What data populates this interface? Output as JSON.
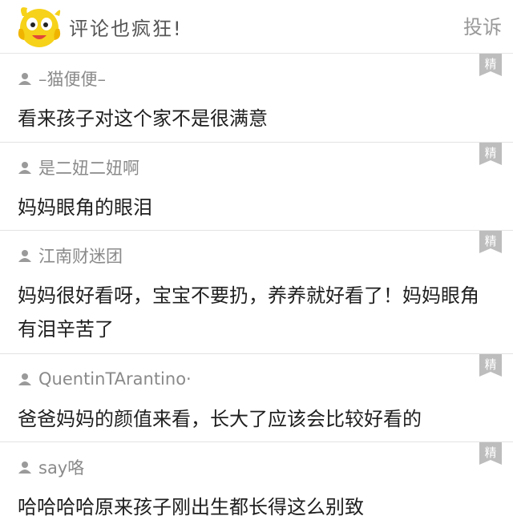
{
  "header": {
    "title": "评论也疯狂!",
    "report_label": "投诉"
  },
  "badge_label": "精",
  "comments": [
    {
      "user": "–猫便便–",
      "text": "看来孩子对这个家不是很满意"
    },
    {
      "user": "是二妞二妞啊",
      "text": "妈妈眼角的眼泪"
    },
    {
      "user": "江南财迷团",
      "text": "妈妈很好看呀，宝宝不要扔，养养就好看了！妈妈眼角有泪辛苦了"
    },
    {
      "user": "QuentinTArantino·",
      "text": "爸爸妈妈的颜值来看，长大了应该会比较好看的"
    },
    {
      "user": "say咯",
      "text": "哈哈哈哈原来孩子刚出生都长得这么别致"
    }
  ],
  "colors": {
    "mascot_yellow": "#f6d21a",
    "badge_gray": "#bdbdbd",
    "divider": "#e3e3e3"
  }
}
